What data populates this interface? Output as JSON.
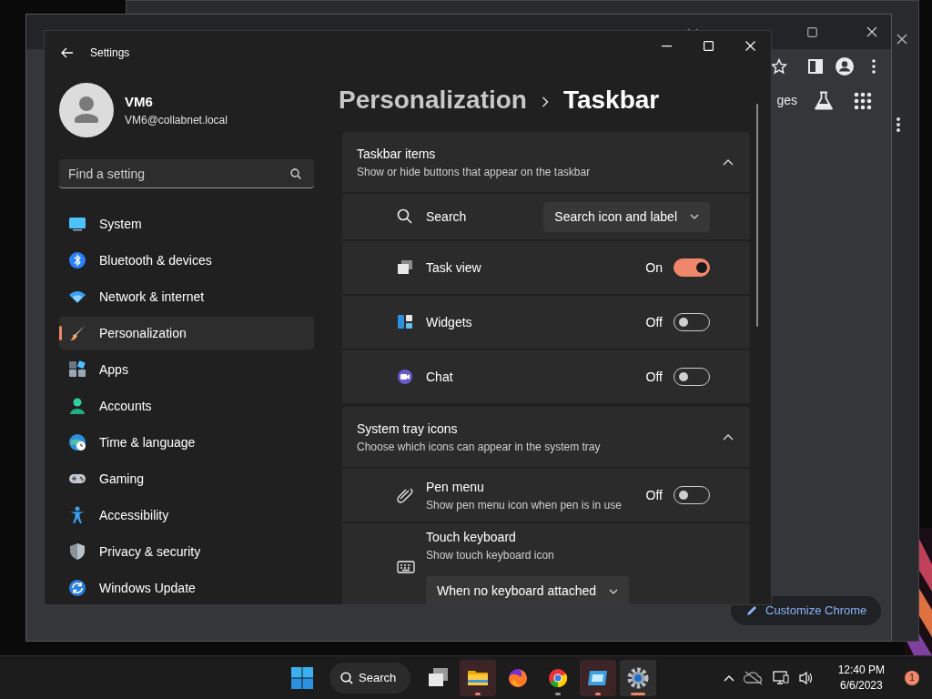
{
  "background_window": {
    "toolbar_text": "ges",
    "button": "Customize Chrome"
  },
  "settings_window": {
    "title": "Settings"
  },
  "profile": {
    "name": "VM6",
    "email": "VM6@collabnet.local"
  },
  "search": {
    "placeholder": "Find a setting"
  },
  "nav": [
    {
      "label": "System",
      "selected": false
    },
    {
      "label": "Bluetooth & devices",
      "selected": false
    },
    {
      "label": "Network & internet",
      "selected": false
    },
    {
      "label": "Personalization",
      "selected": true
    },
    {
      "label": "Apps",
      "selected": false
    },
    {
      "label": "Accounts",
      "selected": false
    },
    {
      "label": "Time & language",
      "selected": false
    },
    {
      "label": "Gaming",
      "selected": false
    },
    {
      "label": "Accessibility",
      "selected": false
    },
    {
      "label": "Privacy & security",
      "selected": false
    },
    {
      "label": "Windows Update",
      "selected": false
    }
  ],
  "breadcrumb": [
    "Personalization",
    "Taskbar"
  ],
  "sections": [
    {
      "title": "Taskbar items",
      "subtitle": "Show or hide buttons that appear on the taskbar",
      "expanded": true,
      "rows": [
        {
          "kind": "dropdown",
          "label": "Search",
          "value": "Search icon and label"
        },
        {
          "kind": "toggle",
          "label": "Task view",
          "on": true,
          "state_text": "On"
        },
        {
          "kind": "toggle",
          "label": "Widgets",
          "on": false,
          "state_text": "Off"
        },
        {
          "kind": "toggle",
          "label": "Chat",
          "on": false,
          "state_text": "Off"
        }
      ]
    },
    {
      "title": "System tray icons",
      "subtitle": "Choose which icons can appear in the system tray",
      "expanded": true,
      "rows": [
        {
          "kind": "toggle",
          "label": "Pen menu",
          "description": "Show pen menu icon when pen is in use",
          "on": false,
          "state_text": "Off"
        },
        {
          "kind": "dropdown_below",
          "label": "Touch keyboard",
          "description": "Show touch keyboard icon",
          "value": "When no keyboard attached"
        }
      ]
    }
  ],
  "taskbar": {
    "search_label": "Search",
    "apps": [
      {
        "running": false,
        "attention": false,
        "selected": false
      },
      {
        "running": true,
        "attention": true,
        "selected": false
      },
      {
        "running": false,
        "attention": false,
        "selected": false
      },
      {
        "running": true,
        "attention": false,
        "selected": false
      },
      {
        "running": true,
        "attention": true,
        "selected": false
      },
      {
        "running": true,
        "attention": false,
        "selected": true
      }
    ],
    "time": "12:40 PM",
    "date": "6/6/2023",
    "notification_count": "1"
  }
}
